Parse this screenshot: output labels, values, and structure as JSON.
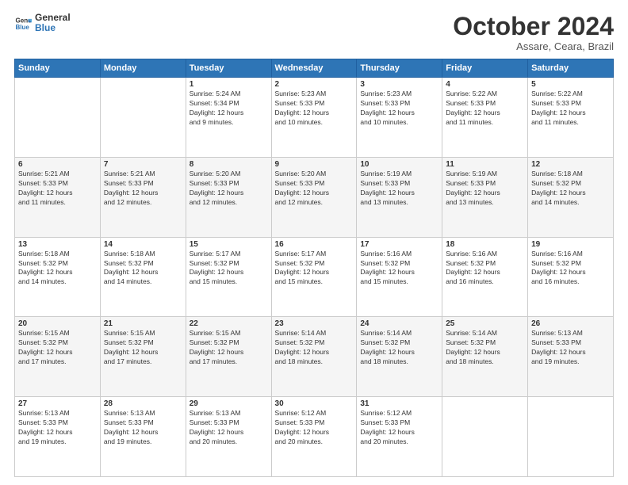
{
  "logo": {
    "line1": "General",
    "line2": "Blue"
  },
  "header": {
    "month": "October 2024",
    "location": "Assare, Ceara, Brazil"
  },
  "weekdays": [
    "Sunday",
    "Monday",
    "Tuesday",
    "Wednesday",
    "Thursday",
    "Friday",
    "Saturday"
  ],
  "weeks": [
    [
      {
        "day": "",
        "info": ""
      },
      {
        "day": "",
        "info": ""
      },
      {
        "day": "1",
        "info": "Sunrise: 5:24 AM\nSunset: 5:34 PM\nDaylight: 12 hours\nand 9 minutes."
      },
      {
        "day": "2",
        "info": "Sunrise: 5:23 AM\nSunset: 5:33 PM\nDaylight: 12 hours\nand 10 minutes."
      },
      {
        "day": "3",
        "info": "Sunrise: 5:23 AM\nSunset: 5:33 PM\nDaylight: 12 hours\nand 10 minutes."
      },
      {
        "day": "4",
        "info": "Sunrise: 5:22 AM\nSunset: 5:33 PM\nDaylight: 12 hours\nand 11 minutes."
      },
      {
        "day": "5",
        "info": "Sunrise: 5:22 AM\nSunset: 5:33 PM\nDaylight: 12 hours\nand 11 minutes."
      }
    ],
    [
      {
        "day": "6",
        "info": "Sunrise: 5:21 AM\nSunset: 5:33 PM\nDaylight: 12 hours\nand 11 minutes."
      },
      {
        "day": "7",
        "info": "Sunrise: 5:21 AM\nSunset: 5:33 PM\nDaylight: 12 hours\nand 12 minutes."
      },
      {
        "day": "8",
        "info": "Sunrise: 5:20 AM\nSunset: 5:33 PM\nDaylight: 12 hours\nand 12 minutes."
      },
      {
        "day": "9",
        "info": "Sunrise: 5:20 AM\nSunset: 5:33 PM\nDaylight: 12 hours\nand 12 minutes."
      },
      {
        "day": "10",
        "info": "Sunrise: 5:19 AM\nSunset: 5:33 PM\nDaylight: 12 hours\nand 13 minutes."
      },
      {
        "day": "11",
        "info": "Sunrise: 5:19 AM\nSunset: 5:33 PM\nDaylight: 12 hours\nand 13 minutes."
      },
      {
        "day": "12",
        "info": "Sunrise: 5:18 AM\nSunset: 5:32 PM\nDaylight: 12 hours\nand 14 minutes."
      }
    ],
    [
      {
        "day": "13",
        "info": "Sunrise: 5:18 AM\nSunset: 5:32 PM\nDaylight: 12 hours\nand 14 minutes."
      },
      {
        "day": "14",
        "info": "Sunrise: 5:18 AM\nSunset: 5:32 PM\nDaylight: 12 hours\nand 14 minutes."
      },
      {
        "day": "15",
        "info": "Sunrise: 5:17 AM\nSunset: 5:32 PM\nDaylight: 12 hours\nand 15 minutes."
      },
      {
        "day": "16",
        "info": "Sunrise: 5:17 AM\nSunset: 5:32 PM\nDaylight: 12 hours\nand 15 minutes."
      },
      {
        "day": "17",
        "info": "Sunrise: 5:16 AM\nSunset: 5:32 PM\nDaylight: 12 hours\nand 15 minutes."
      },
      {
        "day": "18",
        "info": "Sunrise: 5:16 AM\nSunset: 5:32 PM\nDaylight: 12 hours\nand 16 minutes."
      },
      {
        "day": "19",
        "info": "Sunrise: 5:16 AM\nSunset: 5:32 PM\nDaylight: 12 hours\nand 16 minutes."
      }
    ],
    [
      {
        "day": "20",
        "info": "Sunrise: 5:15 AM\nSunset: 5:32 PM\nDaylight: 12 hours\nand 17 minutes."
      },
      {
        "day": "21",
        "info": "Sunrise: 5:15 AM\nSunset: 5:32 PM\nDaylight: 12 hours\nand 17 minutes."
      },
      {
        "day": "22",
        "info": "Sunrise: 5:15 AM\nSunset: 5:32 PM\nDaylight: 12 hours\nand 17 minutes."
      },
      {
        "day": "23",
        "info": "Sunrise: 5:14 AM\nSunset: 5:32 PM\nDaylight: 12 hours\nand 18 minutes."
      },
      {
        "day": "24",
        "info": "Sunrise: 5:14 AM\nSunset: 5:32 PM\nDaylight: 12 hours\nand 18 minutes."
      },
      {
        "day": "25",
        "info": "Sunrise: 5:14 AM\nSunset: 5:32 PM\nDaylight: 12 hours\nand 18 minutes."
      },
      {
        "day": "26",
        "info": "Sunrise: 5:13 AM\nSunset: 5:33 PM\nDaylight: 12 hours\nand 19 minutes."
      }
    ],
    [
      {
        "day": "27",
        "info": "Sunrise: 5:13 AM\nSunset: 5:33 PM\nDaylight: 12 hours\nand 19 minutes."
      },
      {
        "day": "28",
        "info": "Sunrise: 5:13 AM\nSunset: 5:33 PM\nDaylight: 12 hours\nand 19 minutes."
      },
      {
        "day": "29",
        "info": "Sunrise: 5:13 AM\nSunset: 5:33 PM\nDaylight: 12 hours\nand 20 minutes."
      },
      {
        "day": "30",
        "info": "Sunrise: 5:12 AM\nSunset: 5:33 PM\nDaylight: 12 hours\nand 20 minutes."
      },
      {
        "day": "31",
        "info": "Sunrise: 5:12 AM\nSunset: 5:33 PM\nDaylight: 12 hours\nand 20 minutes."
      },
      {
        "day": "",
        "info": ""
      },
      {
        "day": "",
        "info": ""
      }
    ]
  ]
}
